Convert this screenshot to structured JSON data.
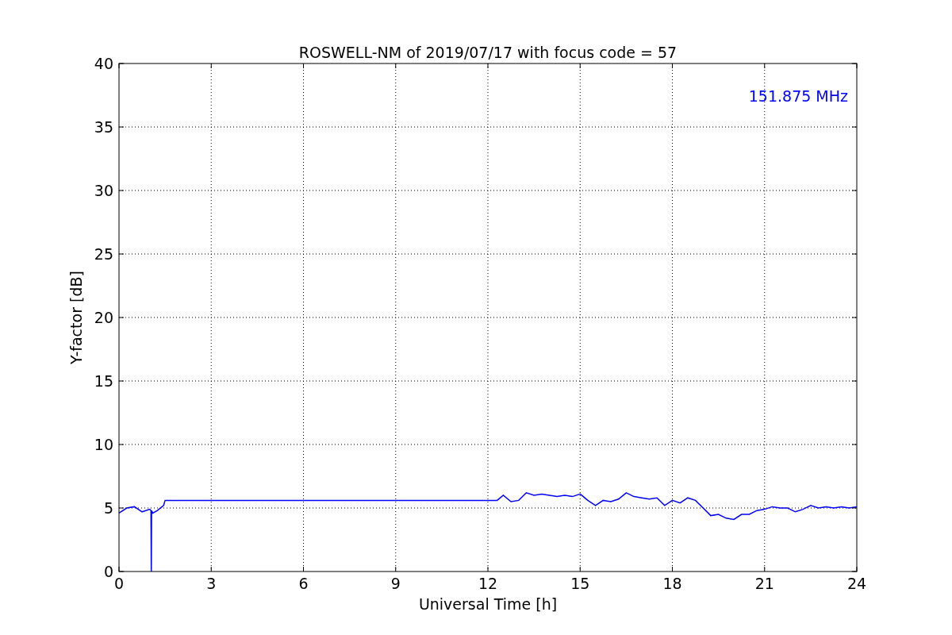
{
  "chart_data": {
    "type": "line",
    "title": "ROSWELL-NM of 2019/07/17 with focus code = 57",
    "xlabel": "Universal Time [h]",
    "ylabel": "Y-factor [dB]",
    "xlim": [
      0,
      24
    ],
    "ylim": [
      0,
      40
    ],
    "xticks": [
      0,
      3,
      6,
      9,
      12,
      15,
      18,
      21,
      24
    ],
    "yticks": [
      0,
      5,
      10,
      15,
      20,
      25,
      30,
      35,
      40
    ],
    "x": [
      0,
      0.25,
      0.5,
      0.75,
      1.0,
      1.04,
      1.05,
      1.06,
      1.1,
      1.25,
      1.45,
      1.5,
      12.3,
      12.5,
      12.75,
      13,
      13.25,
      13.5,
      13.75,
      14,
      14.25,
      14.5,
      14.75,
      15,
      15.25,
      15.5,
      15.75,
      16,
      16.25,
      16.5,
      16.75,
      17,
      17.25,
      17.5,
      17.75,
      18,
      18.25,
      18.5,
      18.75,
      19,
      19.25,
      19.5,
      19.75,
      20,
      20.25,
      20.5,
      20.75,
      21,
      21.25,
      21.5,
      21.75,
      22,
      22.25,
      22.5,
      22.75,
      23,
      23.25,
      23.5,
      23.75,
      24
    ],
    "grid": true,
    "series": [
      {
        "color": "#0000ff",
        "values": [
          4.6,
          5.0,
          5.1,
          4.7,
          4.9,
          4.8,
          0,
          4.8,
          4.6,
          4.8,
          5.2,
          5.6,
          5.6,
          6.0,
          5.5,
          5.6,
          6.2,
          6.0,
          6.1,
          6.0,
          5.9,
          6.0,
          5.9,
          6.1,
          5.6,
          5.2,
          5.6,
          5.5,
          5.7,
          6.2,
          5.9,
          5.8,
          5.7,
          5.8,
          5.2,
          5.6,
          5.4,
          5.8,
          5.6,
          5.0,
          4.4,
          4.5,
          4.2,
          4.1,
          4.5,
          4.5,
          4.8,
          4.9,
          5.1,
          5.0,
          5.0,
          4.7,
          4.9,
          5.2,
          5.0,
          5.1,
          5.0,
          5.1,
          5.0,
          5.1
        ]
      }
    ],
    "annotations": [
      "151.875 MHz"
    ]
  }
}
